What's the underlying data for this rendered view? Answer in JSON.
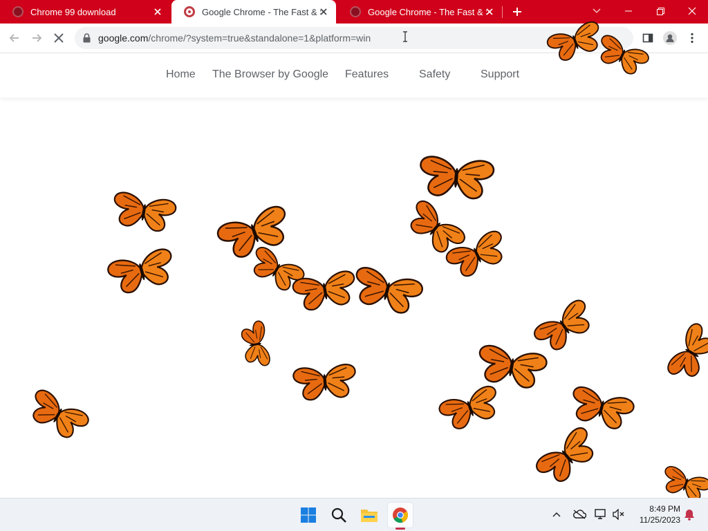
{
  "browser": {
    "tabs": [
      {
        "title": "Chrome 99 download",
        "active": false
      },
      {
        "title": "Google Chrome - The Fast & Secure Web Browser Built to be Yours",
        "active": true
      },
      {
        "title": "Google Chrome - The Fast & Secure Web Browser Built to be Yours",
        "active": false
      }
    ],
    "address": {
      "domain": "google.com",
      "path": "/chrome/?system=true&standalone=1&platform=win"
    },
    "colors": {
      "tabstrip": "#d0021b",
      "toolbar": "#ffffff",
      "omnibox": "#f1f3f4"
    }
  },
  "site": {
    "nav": {
      "home": "Home",
      "browser": "The Browser by Google",
      "features": "Features",
      "safety": "Safety",
      "support": "Support"
    },
    "hero_image": "monarch-butterflies-swarm"
  },
  "taskbar": {
    "apps": [
      "windows-start-icon",
      "search-icon",
      "file-explorer-icon",
      "chrome-icon"
    ],
    "tray": [
      "chevron-up-icon",
      "onedrive-offline-icon",
      "network-display-icon",
      "speaker-muted-icon",
      "notification-bell-icon"
    ],
    "time": "8:49 PM",
    "date": "11/25/2023"
  }
}
